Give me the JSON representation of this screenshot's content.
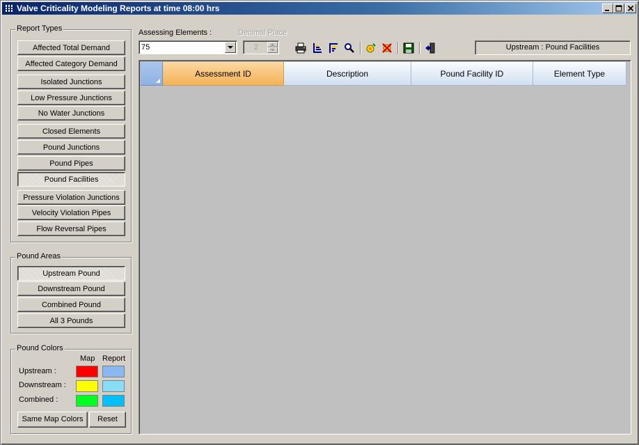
{
  "window": {
    "title": "Valve Criticality Modeling Reports at time 08:00 hrs",
    "controls": [
      "minimize",
      "maximize",
      "close"
    ]
  },
  "report_types": {
    "legend": "Report Types",
    "buttons": [
      {
        "label": "Affected Total Demand",
        "pressed": false
      },
      {
        "label": "Affected Category Demand",
        "pressed": false
      },
      {
        "label": "Isolated Junctions",
        "pressed": false
      },
      {
        "label": "Low Pressure Junctions",
        "pressed": false
      },
      {
        "label": "No Water Junctions",
        "pressed": false
      },
      {
        "label": "Closed Elements",
        "pressed": false
      },
      {
        "label": "Pound Junctions",
        "pressed": false
      },
      {
        "label": "Pound Pipes",
        "pressed": false
      },
      {
        "label": "Pound Facilities",
        "pressed": true
      },
      {
        "label": "Pressure Violation Junctions",
        "pressed": false
      },
      {
        "label": "Velocity Violation Pipes",
        "pressed": false
      },
      {
        "label": "Flow Reversal Pipes",
        "pressed": false
      }
    ]
  },
  "pound_areas": {
    "legend": "Pound Areas",
    "buttons": [
      {
        "label": "Upstream Pound",
        "pressed": true
      },
      {
        "label": "Downstream Pound",
        "pressed": false
      },
      {
        "label": "Combined Pound",
        "pressed": false
      },
      {
        "label": "All 3 Pounds",
        "pressed": false
      }
    ]
  },
  "pound_colors": {
    "legend": "Pound Colors",
    "col_map": "Map",
    "col_report": "Report",
    "rows": [
      {
        "label": "Upstream :",
        "map_color": "#ff0000",
        "report_color": "#8ab8f0"
      },
      {
        "label": "Downstream :",
        "map_color": "#ffff00",
        "report_color": "#88ddf8"
      },
      {
        "label": "Combined :",
        "map_color": "#00ff1e",
        "report_color": "#00c0f8"
      }
    ],
    "same_map_colors_label": "Same Map Colors",
    "reset_label": "Reset"
  },
  "toolbar": {
    "assessing_label": "Assessing Elements :",
    "assessing_value": "75",
    "decimal_label": "Decimal Place",
    "decimal_value": "2",
    "icons": [
      "print-icon",
      "sort-ascending-icon",
      "sort-descending-icon",
      "find-icon",
      "highlight-icon",
      "clear-highlight-icon",
      "save-icon",
      "exit-icon"
    ],
    "status": "Upstream : Pound Facilities"
  },
  "grid": {
    "columns": [
      {
        "label": "Assessment ID",
        "active": true
      },
      {
        "label": "Description",
        "active": false
      },
      {
        "label": "Pound Facility ID",
        "active": false
      },
      {
        "label": "Element Type",
        "active": false
      }
    ],
    "rows": []
  }
}
